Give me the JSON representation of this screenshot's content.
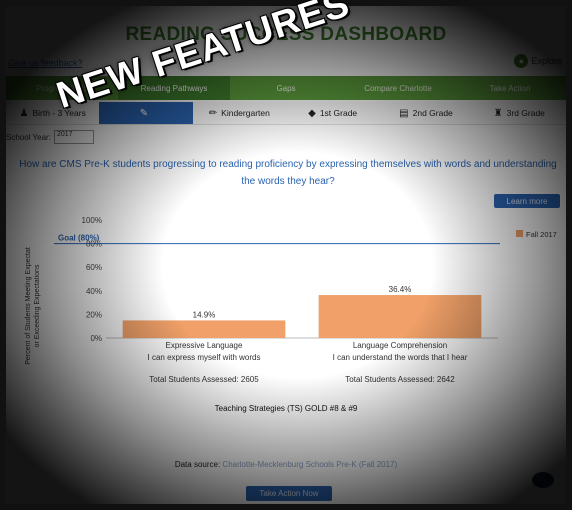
{
  "header": {
    "title": "READING SUCCESS DASHBOARD",
    "feedback_link": "Give us feedback?",
    "explore_label": "Explore"
  },
  "nav": {
    "tabs": [
      {
        "label": "Progress 2025",
        "active": false
      },
      {
        "label": "Reading Pathways",
        "active": true
      },
      {
        "label": "Gaps",
        "active": false
      },
      {
        "label": "Compare Charlotte",
        "active": false
      },
      {
        "label": "Take Action",
        "active": false
      }
    ]
  },
  "age_tabs": [
    {
      "label": "Birth - 3 Years",
      "icon": "child-icon",
      "active": false
    },
    {
      "label": "",
      "icon": "preschool-icon",
      "active": true
    },
    {
      "label": "Kindergarten",
      "icon": "kindergarten-icon",
      "active": false
    },
    {
      "label": "1st Grade",
      "icon": "book-icon",
      "active": false
    },
    {
      "label": "2nd Grade",
      "icon": "books-icon",
      "active": false
    },
    {
      "label": "3rd Grade",
      "icon": "student-icon",
      "active": false
    }
  ],
  "filters": {
    "school_year_label": "School Year:",
    "school_year_value": "2017"
  },
  "question": "How are CMS Pre-K students progressing to reading proficiency by expressing themselves with words and understanding the words they hear?",
  "learn_more": "Learn more",
  "banner": "NEW FEATURES",
  "chart_data": {
    "type": "bar",
    "categories": [
      "Expressive Language",
      "Language Comprehension"
    ],
    "category_sublabels": [
      "I can express myself with words",
      "I can understand the words that I hear"
    ],
    "category_totals": [
      "Total Students Assessed: 2605",
      "Total Students Assessed: 2642"
    ],
    "series": [
      {
        "name": "Fall 2017",
        "values": [
          14.9,
          36.4
        ],
        "color": "#f0a068"
      }
    ],
    "data_labels": [
      "14.9%",
      "36.4%"
    ],
    "ylabel": "Percent of Students Meeting Expectations or Exceeding Expectations",
    "ylabel_lines": [
      "Percent of Students Meeting Expectat",
      "or Exceeding Expectations"
    ],
    "ylim": [
      0,
      100
    ],
    "yticks": [
      0,
      20,
      40,
      60,
      80,
      100
    ],
    "ytick_labels": [
      "0%",
      "20%",
      "40%",
      "60%",
      "80%",
      "100%"
    ],
    "goal": {
      "label": "Goal (80%)",
      "value": 80,
      "color": "#2a63b0"
    },
    "legend_position": "right",
    "grid": false
  },
  "footnote": "Teaching Strategies (TS) GOLD #8 & #9",
  "datasource": {
    "label": "Data source:",
    "source": "Charlotte-Mecklenburg Schools Pre-K (Fall 2017)"
  },
  "action_button": "Take Action Now",
  "colors": {
    "brand_green": "#3e7d2c",
    "nav_green": "#5b9a3c",
    "accent_blue": "#2a63b0",
    "bar": "#f0a068"
  }
}
